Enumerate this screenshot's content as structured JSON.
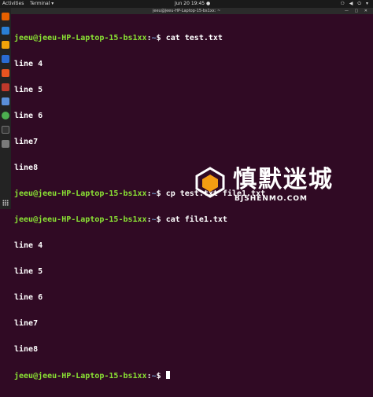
{
  "topbar": {
    "activities": "Activities",
    "app": "Terminal ▾",
    "clock": "Jun 20  19:45 ●",
    "tray": "⚇ ◀ ⏻ ▾"
  },
  "window": {
    "title": "jeeu@jeeu-HP-Laptop-15-bs1xx: ~",
    "controls": "— ▢ ✕"
  },
  "terminal": {
    "prompt_user": "jeeu@jeeu-HP-Laptop-15-bs1xx",
    "prompt_path": "~",
    "cmd1": "cat test.txt",
    "out1": [
      "line 4",
      "line 5",
      "line 6",
      "line7",
      "line8"
    ],
    "cmd2": "cp test.txt file1.txt",
    "cmd3": "cat file1.txt",
    "out3": [
      "line 4",
      "line 5",
      "line 6",
      "line7",
      "line8"
    ]
  },
  "dock": {
    "icons": [
      "firefox-icon",
      "thunderbird-icon",
      "files-icon",
      "rhythmbox-icon",
      "libreoffice-writer-icon",
      "software-icon",
      "help-icon",
      "chrome-icon",
      "terminal-icon",
      "settings-icon",
      "apps-grid-icon"
    ],
    "colors": [
      "#e66000",
      "#2a7fd4",
      "#8f8f8f",
      "#f0a30a",
      "#2a6bd1",
      "#e95420",
      "#5a8fd8",
      "#4caf50",
      "#333333",
      "#7a7a7a"
    ]
  },
  "watermark": {
    "title": "慎默迷城",
    "subtitle": "BJSHENMO.COM"
  }
}
